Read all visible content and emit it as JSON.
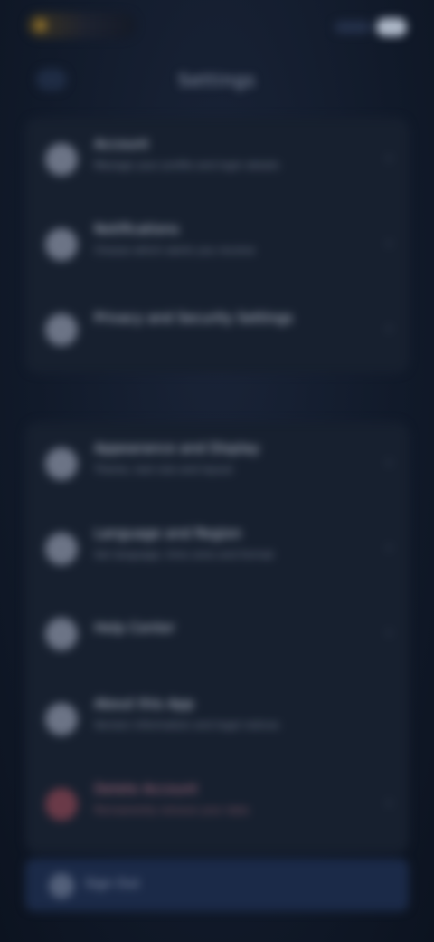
{
  "header": {
    "title": "Settings"
  },
  "sections": [
    {
      "items": [
        {
          "title": "Account",
          "subtitle": "Manage your profile and login details"
        },
        {
          "title": "Notifications",
          "subtitle": "Choose which alerts you receive"
        },
        {
          "title": "Privacy and Security Settings",
          "subtitle": ""
        }
      ]
    },
    {
      "items": [
        {
          "title": "Appearance and Display",
          "subtitle": "Theme, text size and layout"
        },
        {
          "title": "Language and Region",
          "subtitle": "Set language, time zone and format"
        },
        {
          "title": "Help Center",
          "subtitle": ""
        },
        {
          "title": "About this App",
          "subtitle": "Version information and legal notices"
        },
        {
          "title": "Delete Account",
          "subtitle": "Permanently remove your data"
        }
      ]
    }
  ],
  "footer": {
    "button_label": "Sign Out"
  },
  "colors": {
    "background": "#111a2a",
    "card": "#17202f",
    "danger": "#b57386",
    "footer_button": "#1b2a48"
  }
}
